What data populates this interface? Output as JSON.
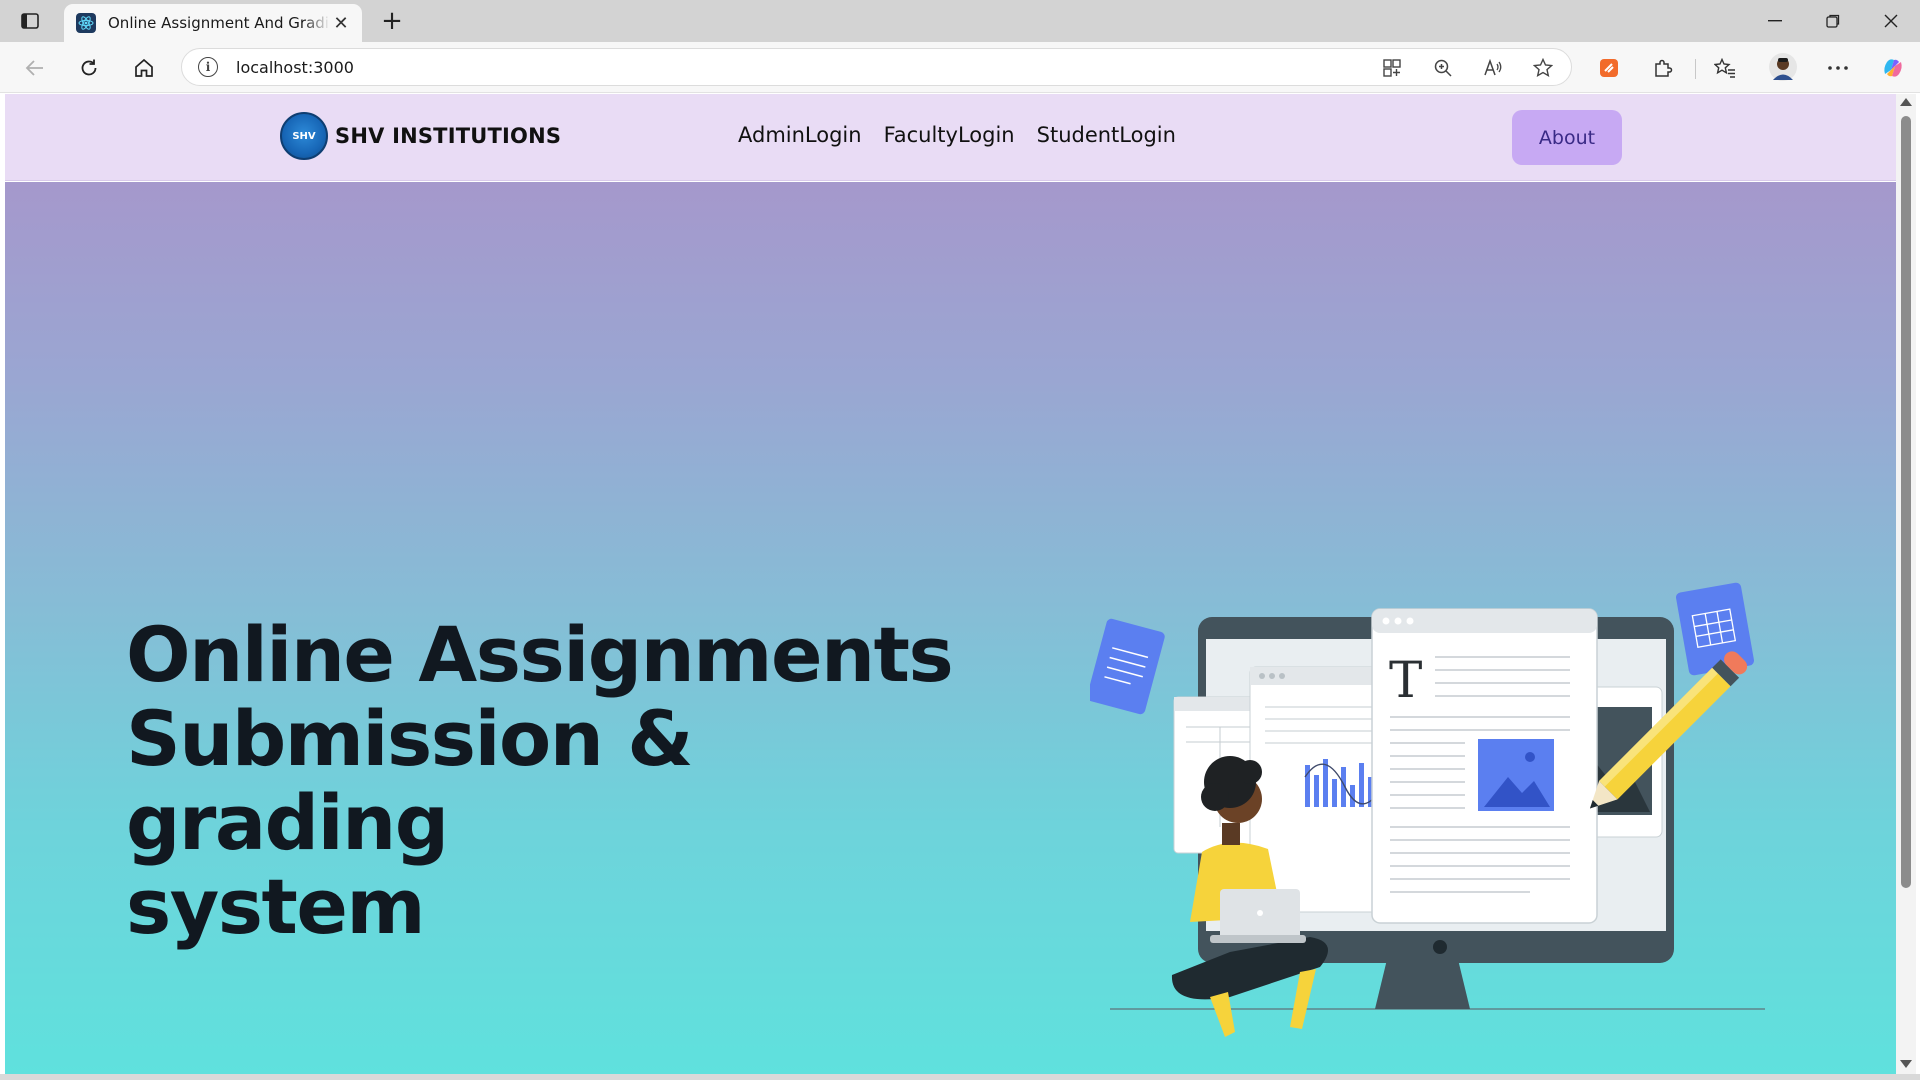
{
  "browser": {
    "tab_title": "Online Assignment And Grading System",
    "url": "localhost:3000",
    "icons": [
      "tab-actions-icon",
      "react-favicon-icon",
      "close-tab-icon",
      "new-tab-icon",
      "minimize-icon",
      "restore-icon",
      "close-window-icon",
      "back-icon",
      "refresh-icon",
      "home-icon",
      "info-icon",
      "app-grid-icon",
      "zoom-icon",
      "read-aloud-icon",
      "favorite-star-icon",
      "extension-orange-icon",
      "extensions-puzzle-icon",
      "favorites-icon",
      "profile-avatar-icon",
      "more-menu-icon",
      "copilot-icon"
    ]
  },
  "navbar": {
    "brand_logo_text": "SHV",
    "brand_name": "SHV INSTITUTIONS",
    "links": [
      "AdminLogin",
      "FacultyLogin",
      "StudentLogin"
    ],
    "about_label": "About"
  },
  "hero": {
    "title_lines": [
      "Online Assignments",
      "Submission & grading",
      "system"
    ],
    "illustration_letter": "T"
  },
  "colors": {
    "navbar_bg": "#e9dcf5",
    "about_bg": "#c7a9f3",
    "hero_top": "#a598cc",
    "hero_bottom": "#5fe1dd",
    "accent_blue": "#5b7ff0",
    "accent_yellow": "#f6d33b"
  }
}
